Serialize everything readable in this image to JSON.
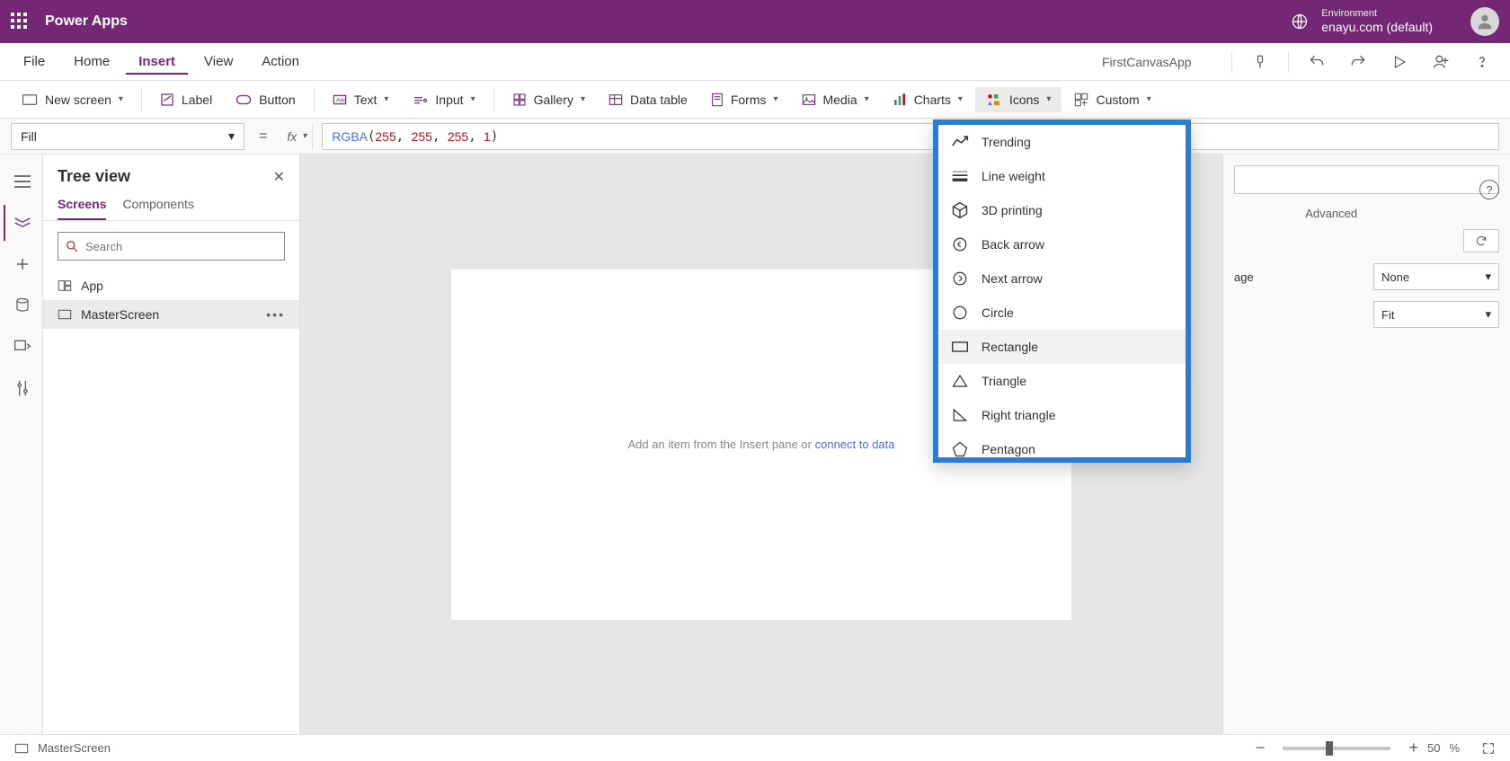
{
  "titlebar": {
    "app_name": "Power Apps",
    "env_label": "Environment",
    "env_value": "enayu.com (default)"
  },
  "menubar": {
    "items": [
      "File",
      "Home",
      "Insert",
      "View",
      "Action"
    ],
    "active_index": 2,
    "app_name": "FirstCanvasApp"
  },
  "ribbon": {
    "new_screen": "New screen",
    "label": "Label",
    "button": "Button",
    "text": "Text",
    "input": "Input",
    "gallery": "Gallery",
    "data_table": "Data table",
    "forms": "Forms",
    "media": "Media",
    "charts": "Charts",
    "icons": "Icons",
    "custom": "Custom"
  },
  "formula": {
    "property": "Fill",
    "fn": "RGBA",
    "args": [
      "255",
      "255",
      "255",
      "1"
    ]
  },
  "tree": {
    "title": "Tree view",
    "tabs": [
      "Screens",
      "Components"
    ],
    "search_placeholder": "Search",
    "items": [
      {
        "label": "App"
      },
      {
        "label": "MasterScreen"
      }
    ]
  },
  "canvas": {
    "hint_prefix": "Add an item from the Insert pane",
    "hint_mid": " or ",
    "hint_link": "connect to data"
  },
  "icons_dropdown": [
    "Trending",
    "Line weight",
    "3D printing",
    "Back arrow",
    "Next arrow",
    "Circle",
    "Rectangle",
    "Triangle",
    "Right triangle",
    "Pentagon"
  ],
  "right_panel": {
    "tab_advanced": "Advanced",
    "prop_image": "age",
    "prop_image_obscured": "Background image",
    "image_value": "None",
    "fit_value": "Fit"
  },
  "statusbar": {
    "screen": "MasterScreen",
    "zoom": "50",
    "zoom_suffix": "%"
  }
}
